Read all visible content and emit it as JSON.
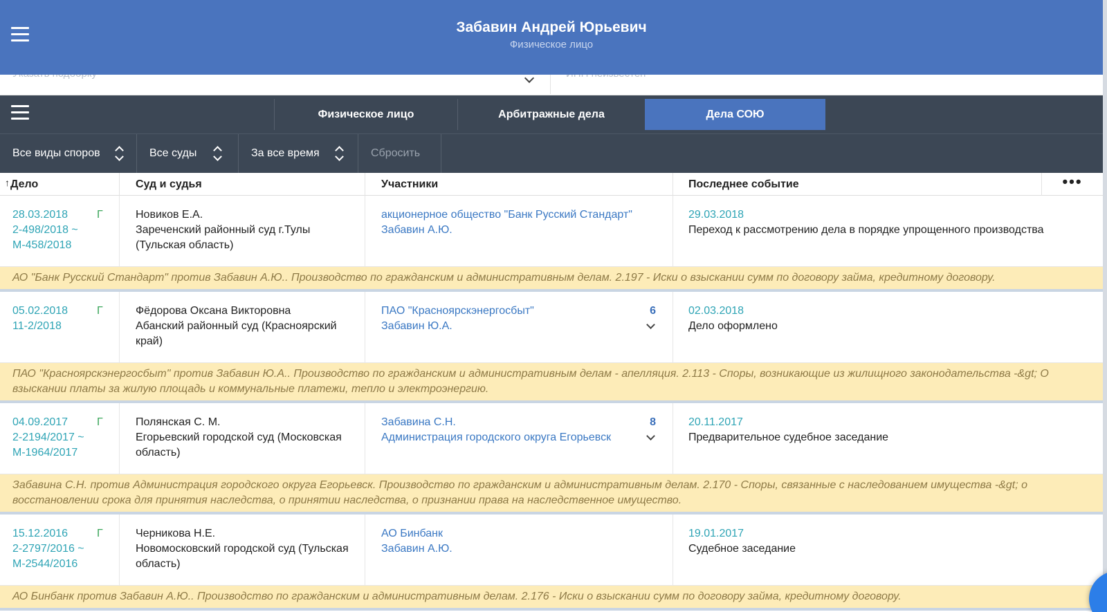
{
  "header": {
    "title": "Забавин Андрей Юрьевич",
    "subtitle": "Физическое лицо"
  },
  "filterbar": {
    "selection_placeholder": "Указать подборку",
    "inn_placeholder": "ИНН неизвестен"
  },
  "tabs": [
    {
      "label": "Физическое лицо",
      "active": false
    },
    {
      "label": "Арбитражные дела",
      "active": false
    },
    {
      "label": "Дела СОЮ",
      "active": true
    }
  ],
  "filters": {
    "disputes": "Все виды споров",
    "courts": "Все суды",
    "period": "За все время",
    "reset": "Сбросить"
  },
  "table": {
    "headers": {
      "case": "Дело",
      "court": "Суд и судья",
      "participants": "Участники",
      "last_event": "Последнее событие",
      "more": "•••"
    },
    "sort_indicator": "↑",
    "rows": [
      {
        "date": "28.03.2018",
        "badge": "Г",
        "numbers": [
          "2-498/2018 ~",
          "М-458/2018"
        ],
        "judge": "Новиков Е.А.",
        "court": "Зареченский районный суд г.Тулы (Тульская область)",
        "participants": [
          "акционерное общество \"Банк Русский Стандарт\"",
          "Забавин А.Ю."
        ],
        "count": "",
        "event_date": "29.03.2018",
        "event": "Переход к рассмотрению дела в порядке упрощенного производства",
        "description": "АО \"Банк Русский Стандарт\" против Забавин А.Ю.. Производство по гражданским и административным делам. 2.197 - Иски о взыскании сумм по договору займа, кредитному договору."
      },
      {
        "date": "05.02.2018",
        "badge": "Г",
        "numbers": [
          "11-2/2018"
        ],
        "judge": "Фёдорова Оксана Викторовна",
        "court": "Абанский районный суд (Красноярский край)",
        "participants": [
          "ПАО \"Красноярскэнергосбыт\"",
          "Забавин Ю.А."
        ],
        "count": "6",
        "event_date": "02.03.2018",
        "event": "Дело оформлено",
        "description": "ПАО \"Красноярскэнергосбыт\" против Забавин Ю.А.. Производство по гражданским и административным делам - апелляция. 2.113 - Споры, возникающие из жилищного законодательства -&gt; О взыскании платы за жилую площадь и коммунальные платежи, тепло и электроэнергию."
      },
      {
        "date": "04.09.2017",
        "badge": "Г",
        "numbers": [
          "2-2194/2017 ~",
          "М-1964/2017"
        ],
        "judge": "Полянская С. М.",
        "court": "Егорьевский городской суд (Московская область)",
        "participants": [
          "Забавина С.Н.",
          "Администрация городского округа Егорьевск"
        ],
        "count": "8",
        "event_date": "20.11.2017",
        "event": "Предварительное судебное заседание",
        "description": "Забавина С.Н. против Администрация городского округа Егорьевск. Производство по гражданским и административным делам. 2.170 - Споры, связанные с наследованием имущества -&gt; о восстановлении срока для принятия наследства, о принятии наследства, о признании права на наследственное имущество."
      },
      {
        "date": "15.12.2016",
        "badge": "Г",
        "numbers": [
          "2-2797/2016 ~",
          "М-2544/2016"
        ],
        "judge": "Черникова Н.Е.",
        "court": "Новомосковский городской суд (Тульская область)",
        "participants": [
          "АО Бинбанк",
          "Забавин А.Ю."
        ],
        "count": "",
        "event_date": "19.01.2017",
        "event": "Судебное заседание",
        "description": "АО Бинбанк против Забавин А.Ю.. Производство по гражданским и административным делам. 2.176 - Иски о взыскании сумм по договору займа, кредитному договору."
      }
    ]
  }
}
